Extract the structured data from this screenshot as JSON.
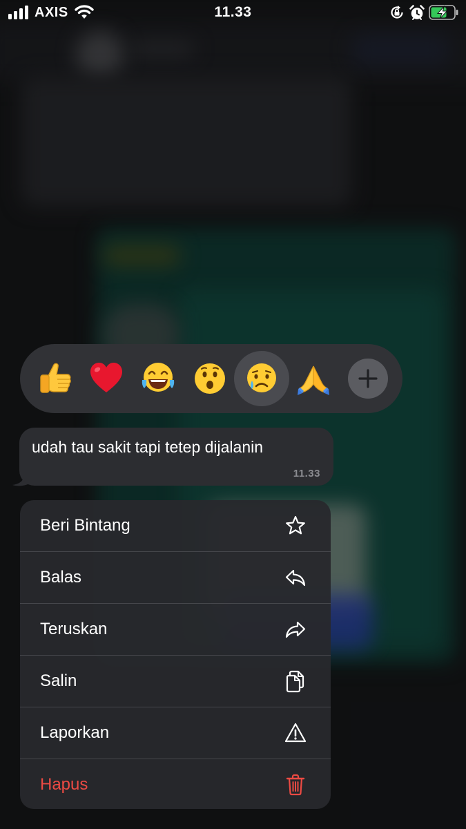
{
  "status_bar": {
    "carrier": "AXIS",
    "time": "11.33",
    "icons": [
      "signal-icon",
      "wifi-icon",
      "orientation-lock-icon",
      "alarm-icon",
      "battery-charging-icon"
    ]
  },
  "reactions": {
    "items": [
      {
        "name": "thumbs-up",
        "emoji": "👍"
      },
      {
        "name": "red-heart",
        "emoji": "❤️"
      },
      {
        "name": "tears-of-joy",
        "emoji": "😂"
      },
      {
        "name": "surprised",
        "emoji": "😮"
      },
      {
        "name": "crying",
        "emoji": "😢",
        "selected": true
      },
      {
        "name": "folded-hands",
        "emoji": "🙏"
      }
    ],
    "more_icon": "plus-icon"
  },
  "message": {
    "text": "udah tau sakit tapi tetep dijalanin",
    "time": "11.33"
  },
  "menu": {
    "items": [
      {
        "label": "Beri Bintang",
        "icon": "star-icon"
      },
      {
        "label": "Balas",
        "icon": "reply-icon"
      },
      {
        "label": "Teruskan",
        "icon": "forward-icon"
      },
      {
        "label": "Salin",
        "icon": "copy-icon"
      },
      {
        "label": "Laporkan",
        "icon": "warning-icon"
      },
      {
        "label": "Hapus",
        "icon": "trash-icon",
        "destructive": true
      }
    ]
  },
  "colors": {
    "menu_background": "#28292d",
    "bubble_background": "#2c2d31",
    "reaction_bar_background": "#313236",
    "destructive": "#ec4a43",
    "text": "#ffffff",
    "timestamp": "#8b8c91",
    "battery_charging": "#35c759"
  }
}
